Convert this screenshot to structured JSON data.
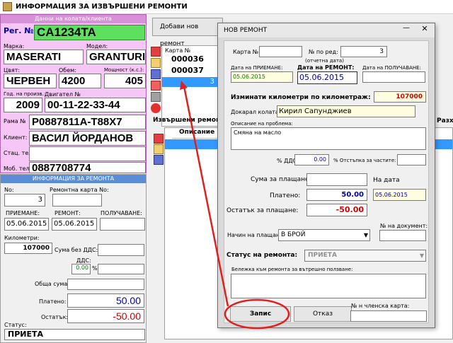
{
  "window": {
    "title": "ИНФОРМАЦИЯ ЗА ИЗВЪРШЕНИ РЕМОНТИ"
  },
  "vehicle": {
    "header": "Данни на колата/клиента",
    "reg_label": "Рег. №",
    "reg_value": "CA1234TA",
    "make_label": "Марка:",
    "make_value": "MASERATI",
    "model_label": "Модел:",
    "model_value": "GRANTURIS",
    "color_label": "Цвят:",
    "color_value": "ЧЕРВЕН",
    "volume_label": "Обем:",
    "volume_value": "4200",
    "power_label": "Мощност (к.с.):",
    "power_value": "405",
    "year_label": "Год. на произв.:",
    "year_value": "2009",
    "engine_label": "Двигател №",
    "engine_value": "00-11-22-33-44",
    "frame_label": "Рама №",
    "frame_value": "P0887811A-T88X7",
    "client_label": "Клиент:",
    "client_value": "ВАСИЛ ЙОРДАНОВ",
    "home_phone_label": "Стац. тел.:",
    "home_phone_value": "",
    "mobile_label": "Моб. тел.:",
    "mobile_value": "0887708774"
  },
  "repair_info": {
    "header": "ИНФОРМАЦИЯ ЗА РЕМОНТА",
    "no_label": "No:",
    "no_value": "3",
    "card_label": "Ремонтна карта No:",
    "card_value": "",
    "intake_label": "ПРИЕМАНЕ:",
    "intake_value": "05.06.2015",
    "repair_label": "РЕМОНТ:",
    "repair_value": "05.06.2015",
    "pickup_label": "ПОЛУЧАВАНЕ:",
    "pickup_value": "",
    "km_label": "Километри:",
    "km_value": "107000",
    "sum_novat_label": "Сума без ДДС:",
    "sum_novat_value": "",
    "vat_label": "ДДС:",
    "vat_value": "0.00",
    "pct_label": "%",
    "total_label": "Обща сума:",
    "total_value": "",
    "paid_label": "Платено:",
    "paid_value": "50.00",
    "remain_label": "Остатък:",
    "remain_value": "-50.00",
    "status_label": "Статус:",
    "status_value": "ПРИЕТА"
  },
  "middle": {
    "add_button": "Добави нов ремонт",
    "card_col": "Карта №",
    "rows": [
      "000036",
      "000037",
      "3"
    ],
    "done_repairs_header": "Извършени ремонти",
    "desc_col": "Описание на"
  },
  "right": {
    "col_text": "Разхо"
  },
  "dialog": {
    "title": "НОВ РЕМОНТ",
    "card_no_label": "Карта №",
    "card_no_value": "",
    "seq_label": "№ по ред:",
    "seq_value": "3",
    "seq_note": "(отчетна дата)",
    "intake_label": "Дата на ПРИЕМАНЕ:",
    "intake_value": "05.06.2015",
    "repair_label": "Дата на РЕМОНТ:",
    "repair_value": "05.06.2015",
    "pickup_label": "Дата на ПОЛУЧАВАНЕ:",
    "pickup_value": "",
    "km_label": "Изминати километри по километраж:",
    "km_value": "107000",
    "brought_label": "Докарал колата:",
    "brought_value": "Кирил Сапунджиев",
    "problem_label": "Описание на проблема:",
    "problem_value": "Смяна на масло",
    "vat_label": "% ДДС:",
    "vat_value": "0.00",
    "discount_label": "% Отстъпка за частите:",
    "discount_value": "",
    "sum_label": "Сума за плащане:",
    "sum_value": "",
    "date_label": "На дата",
    "date_value": "05.06.2015",
    "paid_label": "Платено:",
    "paid_value": "50.00",
    "remain_label": "Остатък за плащане:",
    "remain_value": "-50.00",
    "pay_method_label": "Начин на плащане:",
    "pay_method_value": "В БРОЙ",
    "doc_label": "№ на документ:",
    "doc_value": "",
    "status_label": "Статус на ремонта:",
    "status_value": "ПРИЕТА",
    "note_label": "Бележка към ремонта за вътрешно ползване:",
    "note_value": "",
    "save_button": "Запис",
    "cancel_button": "Отказ",
    "member_label": "№ н членска карта:",
    "member_value": ""
  }
}
